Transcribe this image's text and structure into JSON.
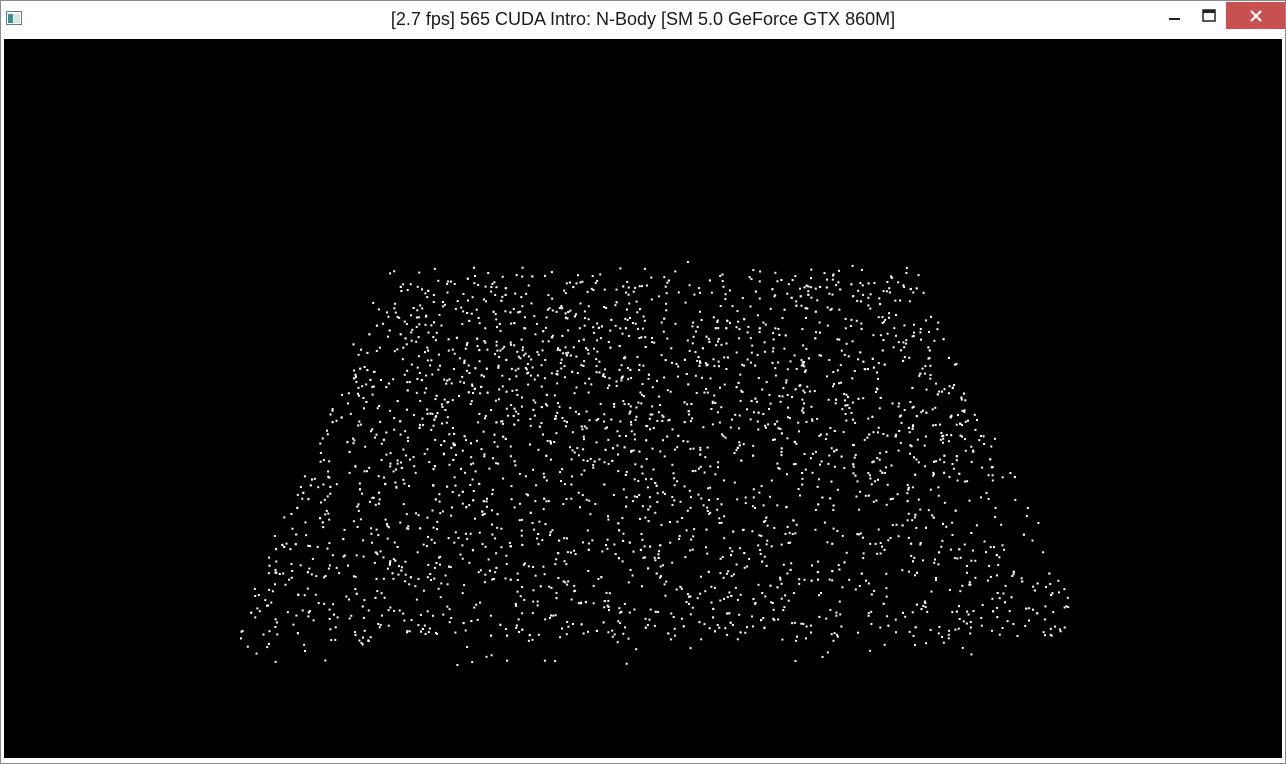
{
  "window": {
    "title": "[2.7 fps] 565 CUDA Intro: N-Body [SM 5.0 GeForce GTX 860M]",
    "icon": "app-window-icon",
    "controls": {
      "minimize_icon": "minimize-icon",
      "maximize_icon": "maximize-icon",
      "close_icon": "close-icon",
      "close_color": "#c75050"
    }
  },
  "viewport": {
    "background": "#000000",
    "particle_color": "#ffffff"
  }
}
